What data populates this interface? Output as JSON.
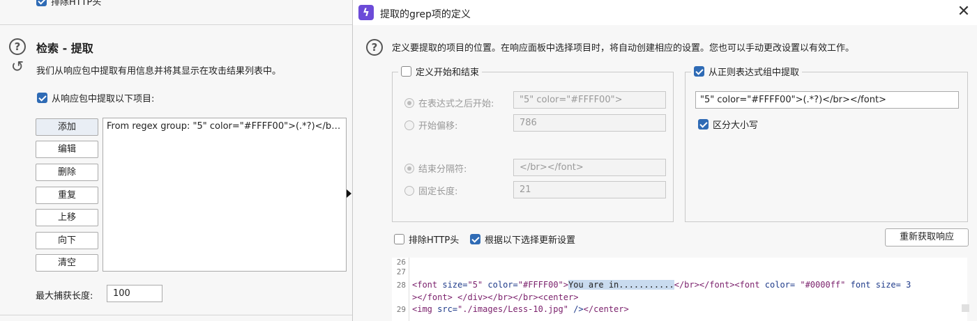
{
  "left": {
    "top_checkbox_label": "排除HTTP头",
    "section_title": "检索 - 提取",
    "section_desc": "我们从响应包中提取有用信息并将其显示在攻击结果列表中。",
    "extract_checkbox_label": "从响应包中提取以下项目:",
    "buttons": {
      "add": "添加",
      "edit": "编辑",
      "delete": "删除",
      "duplicate": "重复",
      "up": "上移",
      "down": "向下",
      "clear": "清空"
    },
    "list_items": [
      "From regex group: \"5\" color=\"#FFFF00\">(.*?)</br..."
    ],
    "max_capture_label": "最大捕获长度:",
    "max_capture_value": "100"
  },
  "dialog": {
    "title": "提取的grep项的定义",
    "description": "定义要提取的项目的位置。在响应面板中选择项目时，将自动创建相应的设置。您也可以手动更改设置以有效工作。",
    "start_end_group": {
      "legend": "定义开始和结束",
      "start_after_label": "在表达式之后开始:",
      "start_after_value": "\"5\" color=\"#FFFF00\">",
      "start_offset_label": "开始偏移:",
      "start_offset_value": "786",
      "end_delimiter_label": "结束分隔符:",
      "end_delimiter_value": "</br></font>",
      "fixed_length_label": "固定长度:",
      "fixed_length_value": "21"
    },
    "regex_group": {
      "legend": "从正则表达式组中提取",
      "regex_value": "\"5\" color=\"#FFFF00\">(.*?)</br></font>",
      "case_sensitive_label": "区分大小写"
    },
    "exclude_http_label": "排除HTTP头",
    "update_config_label": "根据以下选择更新设置",
    "refetch_button": "重新获取响应",
    "code": {
      "line_numbers": [
        "26",
        "27",
        "28",
        "",
        "29"
      ],
      "l28_a": "<font",
      "l28_b": " size=",
      "l28_c": "\"5\"",
      "l28_d": " color=",
      "l28_e": "\"#FFFF00\"",
      "l28_f": ">",
      "l28_sel": "You are in...........",
      "l28_g": "</br></font><font",
      "l28_h": " color= ",
      "l28_i": "\"#0000ff\"",
      "l28_j": " font size= 3",
      "l28b_a": "></font>",
      "l28b_b": " ",
      "l28b_c": "</div></br></br><center>",
      "l29_a": "<img",
      "l29_b": " src=",
      "l29_c": "\"./images/Less-10.jpg\"",
      "l29_d": " />",
      "l29_e": "</center>"
    }
  },
  "colors": {
    "accent_checkbox": "#2f6bb5",
    "app_icon": "#6c4bd8",
    "selection_highlight": "#c9dbef"
  },
  "icons": [
    "help-icon",
    "reset-icon",
    "app-icon",
    "close-icon",
    "splitter-arrow-icon"
  ]
}
